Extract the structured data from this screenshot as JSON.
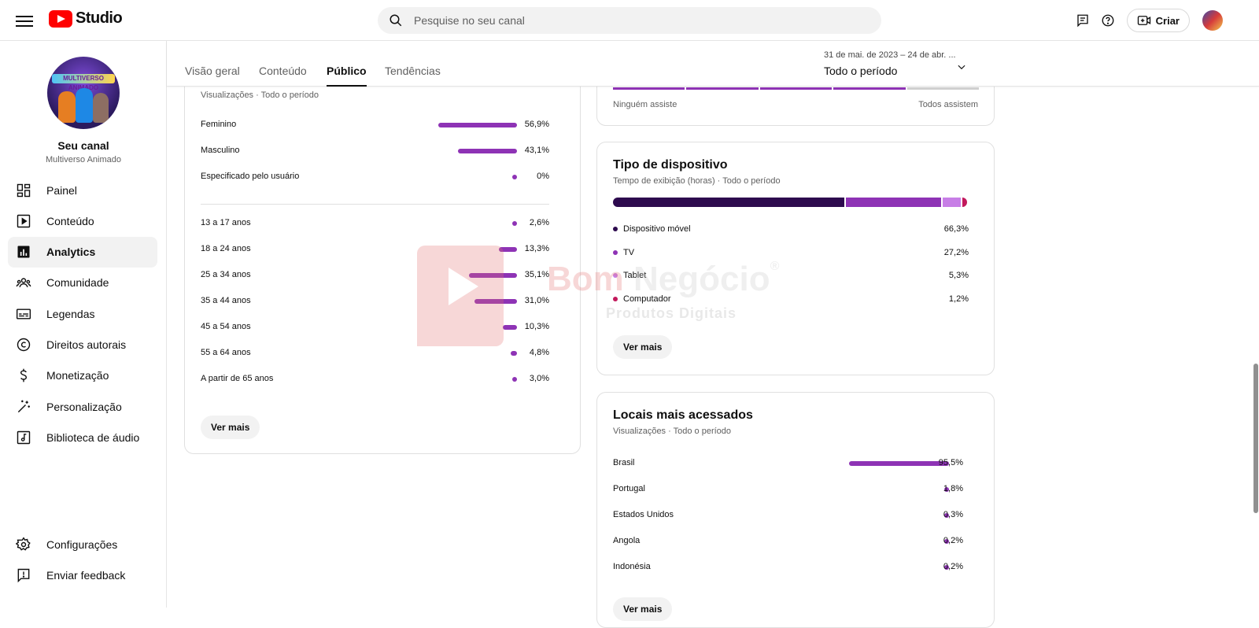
{
  "header": {
    "logo_text": "Studio",
    "search_placeholder": "Pesquise no seu canal",
    "create_label": "Criar"
  },
  "sidebar": {
    "avatar_text": "MULTIVERSO ANIMADO",
    "channel_title": "Seu canal",
    "channel_name": "Multiverso Animado",
    "items": [
      {
        "label": "Painel",
        "icon": "dashboard-icon"
      },
      {
        "label": "Conteúdo",
        "icon": "content-icon"
      },
      {
        "label": "Analytics",
        "icon": "analytics-icon",
        "active": true
      },
      {
        "label": "Comunidade",
        "icon": "community-icon"
      },
      {
        "label": "Legendas",
        "icon": "subtitles-icon"
      },
      {
        "label": "Direitos autorais",
        "icon": "copyright-icon"
      },
      {
        "label": "Monetização",
        "icon": "monetization-icon"
      },
      {
        "label": "Personalização",
        "icon": "customization-icon"
      },
      {
        "label": "Biblioteca de áudio",
        "icon": "audio-library-icon"
      }
    ],
    "bottom_items": [
      {
        "label": "Configurações",
        "icon": "settings-icon"
      },
      {
        "label": "Enviar feedback",
        "icon": "feedback-icon"
      }
    ]
  },
  "tabs": [
    {
      "label": "Visão geral"
    },
    {
      "label": "Conteúdo"
    },
    {
      "label": "Público",
      "active": true
    },
    {
      "label": "Tendências"
    }
  ],
  "date_range": {
    "range": "31 de mai. de 2023 – 24 de abr. ...",
    "period": "Todo o período"
  },
  "demographics": {
    "subtitle": "Visualizações · Todo o período",
    "gender": [
      {
        "label": "Feminino",
        "value": "56,9%",
        "pct": 56.9
      },
      {
        "label": "Masculino",
        "value": "43,1%",
        "pct": 43.1
      },
      {
        "label": "Especificado pelo usuário",
        "value": "0%",
        "pct": 0
      }
    ],
    "age": [
      {
        "label": "13 a 17 anos",
        "value": "2,6%",
        "pct": 2.6
      },
      {
        "label": "18 a 24 anos",
        "value": "13,3%",
        "pct": 13.3
      },
      {
        "label": "25 a 34 anos",
        "value": "35,1%",
        "pct": 35.1
      },
      {
        "label": "35 a 44 anos",
        "value": "31,0%",
        "pct": 31.0
      },
      {
        "label": "45 a 54 anos",
        "value": "10,3%",
        "pct": 10.3
      },
      {
        "label": "55 a 64 anos",
        "value": "4,8%",
        "pct": 4.8
      },
      {
        "label": "A partir de 65 anos",
        "value": "3,0%",
        "pct": 3.0
      }
    ],
    "more_label": "Ver mais"
  },
  "watch_card": {
    "left_label": "Ninguém assiste",
    "right_label": "Todos assistem"
  },
  "device": {
    "title": "Tipo de dispositivo",
    "subtitle": "Tempo de exibição (horas) · Todo o período",
    "items": [
      {
        "label": "Dispositivo móvel",
        "value": "66,3%",
        "pct": 66.3,
        "color": "#2d0a4e"
      },
      {
        "label": "TV",
        "value": "27,2%",
        "pct": 27.2,
        "color": "#8e33b5"
      },
      {
        "label": "Tablet",
        "value": "5,3%",
        "pct": 5.3,
        "color": "#c77ee6"
      },
      {
        "label": "Computador",
        "value": "1,2%",
        "pct": 1.2,
        "color": "#c2185b"
      }
    ],
    "more_label": "Ver mais"
  },
  "locations": {
    "title": "Locais mais acessados",
    "subtitle": "Visualizações · Todo o período",
    "items": [
      {
        "label": "Brasil",
        "value": "95,5%",
        "pct": 95.5
      },
      {
        "label": "Portugal",
        "value": "1,8%",
        "pct": 1.8
      },
      {
        "label": "Estados Unidos",
        "value": "0,3%",
        "pct": 0.3
      },
      {
        "label": "Angola",
        "value": "0,2%",
        "pct": 0.2
      },
      {
        "label": "Indonésia",
        "value": "0,2%",
        "pct": 0.2
      }
    ],
    "more_label": "Ver mais"
  },
  "watermark": {
    "word1": "Bom",
    "word2": "Negócio",
    "mark": "®",
    "sub": "Produtos Digitais"
  },
  "colors": {
    "accent": "#8e33b5",
    "brand_red": "#ff0000"
  }
}
